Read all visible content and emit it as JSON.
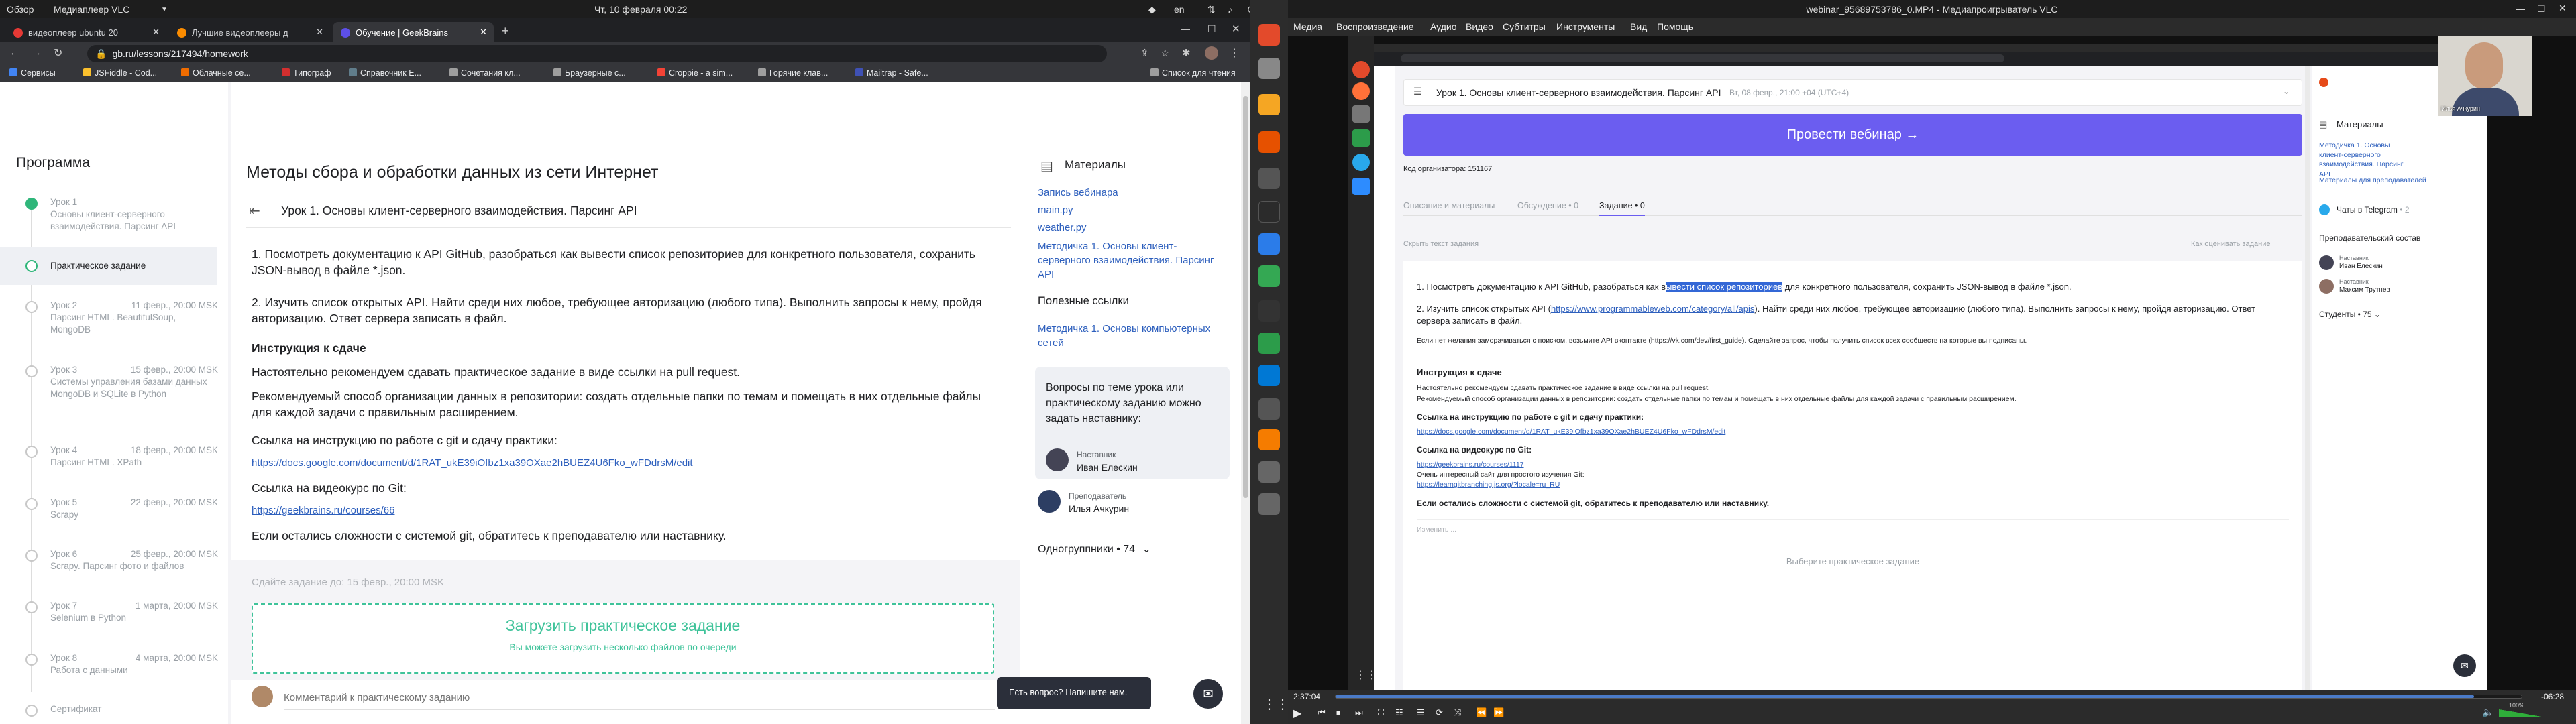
{
  "topbar": {
    "overview": "Обзор",
    "app": "Медиаплеер VLC",
    "clock": "Чт, 10 февраля  00:22",
    "lang": "en"
  },
  "chrome": {
    "tabs": [
      {
        "label": "видеоплеер ubuntu 20"
      },
      {
        "label": "Лучшие видеоплееры д"
      },
      {
        "label": "Обучение | GeekBrains"
      }
    ],
    "url": "gb.ru/lessons/217494/homework",
    "bookmarks": [
      "Сервисы",
      "JSFiddle - Cod...",
      "Облачные се...",
      "Типограф",
      "Справочник Е...",
      "Сочетания кл...",
      "Браузерные с...",
      "Croppie - a sim...",
      "Горячие клав...",
      "Mailtrap - Safe..."
    ],
    "reading_list": "Список для чтения"
  },
  "program": {
    "title": "Программа",
    "lessons": [
      {
        "num": "Урок 1",
        "title": "Основы клиент-серверного взаимодействия. Парсинг API",
        "date": ""
      },
      {
        "num": "",
        "title": "Практическое задание",
        "date": ""
      },
      {
        "num": "Урок 2",
        "title": "Парсинг HTML. BeautifulSoup, MongoDB",
        "date": "11 февр., 20:00 MSK"
      },
      {
        "num": "Урок 3",
        "title": "Системы управления базами данных MongoDB и SQLite в Python",
        "date": "15 февр., 20:00 MSK"
      },
      {
        "num": "Урок 4",
        "title": "Парсинг HTML. XPath",
        "date": "18 февр., 20:00 MSK"
      },
      {
        "num": "Урок 5",
        "title": "Scrapy",
        "date": "22 февр., 20:00 MSK"
      },
      {
        "num": "Урок 6",
        "title": "Scrapy. Парсинг фото и файлов",
        "date": "25 февр., 20:00 MSK"
      },
      {
        "num": "Урок 7",
        "title": "Selenium в Python",
        "date": "1 марта, 20:00 MSK"
      },
      {
        "num": "Урок 8",
        "title": "Работа с данными",
        "date": "4 марта, 20:00 MSK"
      },
      {
        "num": "",
        "title": "Сертификат",
        "date": ""
      }
    ]
  },
  "main": {
    "course_title": "Методы сбора и обработки данных из сети Интернет",
    "lesson_title": "Урок 1. Основы клиент-серверного взаимодействия. Парсинг API",
    "task1": "1. Посмотреть документацию к API GitHub, разобраться как вывести список репозиториев для конкретного пользователя, сохранить JSON-вывод в файле *.json.",
    "task2": "2. Изучить список открытых API. Найти среди них любое, требующее авторизацию (любого типа). Выполнить запросы к нему, пройдя авторизацию. Ответ сервера записать в файл.",
    "instr_title": "Инструкция к сдаче",
    "instr1": "Настоятельно рекомендуем сдавать практическое задание в виде ссылки на pull request.",
    "instr2": "Рекомендуемый способ организации данных в репозитории: создать отдельные папки по темам и помещать в них отдельные файлы для каждой задачи с правильным расширением.",
    "link_label1": "Ссылка на инструкцию по работе с git и сдачу практики:",
    "link1": "https://docs.google.com/document/d/1RAT_ukE39iOfbz1xa39OXae2hBUEZ4U6Fko_wFDdrsM/edit",
    "link_label2": "Ссылка на видеокурс по Git:",
    "link2": "https://geekbrains.ru/courses/66",
    "help": "Если остались сложности с системой git, обратитесь к преподавателю или наставнику.",
    "deadline": "Сдайте задание до: 15 февр., 20:00 MSK",
    "upload_title": "Загрузить практическое задание",
    "upload_sub": "Вы можете загрузить несколько файлов по очереди",
    "comment_placeholder": "Комментарий к практическому заданию"
  },
  "materials": {
    "title": "Материалы",
    "links": [
      "Запись вебинара",
      "main.py",
      "weather.py",
      "Методичка 1. Основы клиент-серверного взаимодействия. Парсинг API"
    ],
    "useful_title": "Полезные ссылки",
    "useful": [
      "Методичка 1. Основы компьютерных сетей"
    ],
    "ask": "Вопросы по теме урока или практическому заданию можно задать наставнику:",
    "mentor_role": "Наставник",
    "mentor_name": "Иван Елескин",
    "teacher_role": "Преподаватель",
    "teacher_name": "Илья Ачкурин",
    "groupmates": "Одногруппники • 74",
    "chat": "Есть вопрос? Напишите нам."
  },
  "vlc": {
    "title": "webinar_95689753786_0.MP4 - Медиапроигрыватель VLC",
    "menu": [
      "Медиа",
      "Воспроизведение",
      "Аудио",
      "Видео",
      "Субтитры",
      "Инструменты",
      "Вид",
      "Помощь"
    ],
    "time_current": "2:37:04",
    "time_remaining": "-06:28",
    "volume": "100%",
    "progress": 0.96,
    "video": {
      "lesson": "Урок 1. Основы клиент-серверного взаимодействия. Парсинг API",
      "lesson_date": "Вт, 08 февр., 21:00 +04 (UTC+4)",
      "cta": "Провести вебинар",
      "org_code": "Код организатора: 151167",
      "tabs": [
        "Описание и материалы",
        "Обсуждение • 0",
        "Задание • 0"
      ],
      "hide": "Скрыть текст задания",
      "how": "Как оценивать задание",
      "t1a": "1. Посмотреть документацию к API GitHub, разобраться как в",
      "t1b": "ывести список репозиториев",
      "t1c": " для конкретного пользователя, сохранить JSON-вывод в файле *.json.",
      "t2a": "2. Изучить список открытых API (",
      "t2link": "https://www.programmableweb.com/category/all/apis",
      "t2b": "). Найти среди них любое, требующее авторизацию (любого типа). Выполнить запросы к нему, пройдя авторизацию. Ответ сервера записать в файл.",
      "vk": "Если нет желания заморачиваться с поиском, возьмите API вконтакте (https://vk.com/dev/first_guide). Сделайте запрос, чтобы получить список всех сообществ на которые вы подписаны.",
      "instr_title": "Инструкция к сдаче",
      "instr1": "Настоятельно рекомендуем сдавать практическое задание в виде ссылки на pull request.",
      "instr2": "Рекомендуемый способ организации данных в репозитории: создать отдельные папки по темам и помещать в них отдельные файлы для каждой задачи с правильным расширением.",
      "l1label": "Ссылка на инструкцию по работе с git и сдачу практики:",
      "l1": "https://docs.google.com/document/d/1RAT_ukE39iOfbz1xa39OXae2hBUEZ4U6Fko_wFDdrsM/edit",
      "l2label": "Ссылка на видеокурс по Git:",
      "l2": "https://geekbrains.ru/courses/1117",
      "l3label": "Очень интересный сайт для простого изучения Git:",
      "l3": "https://learngitbranching.js.org/?locale=ru_RU",
      "help": "Если остались сложности с системой git, обратитесь к преподавателю или наставнику.",
      "edit": "Изменить ...",
      "choose": "Выберите практическое задание",
      "materials": "Материалы",
      "mat_links": [
        "Методичка 1. Основы клиент-серверного взаимодействия. Парсинг API",
        "Материалы для преподавателей"
      ],
      "telegram": "Чаты в Telegram",
      "telegram_count": "• 2",
      "staff": "Преподавательский состав",
      "mentor1_role": "Наставник",
      "mentor1": "Иван Елескин",
      "mentor2_role": "Наставник",
      "mentor2": "Максим Трутнев",
      "students": "Студенты • 75",
      "webcam_name": "Илья Ачкурин"
    }
  }
}
